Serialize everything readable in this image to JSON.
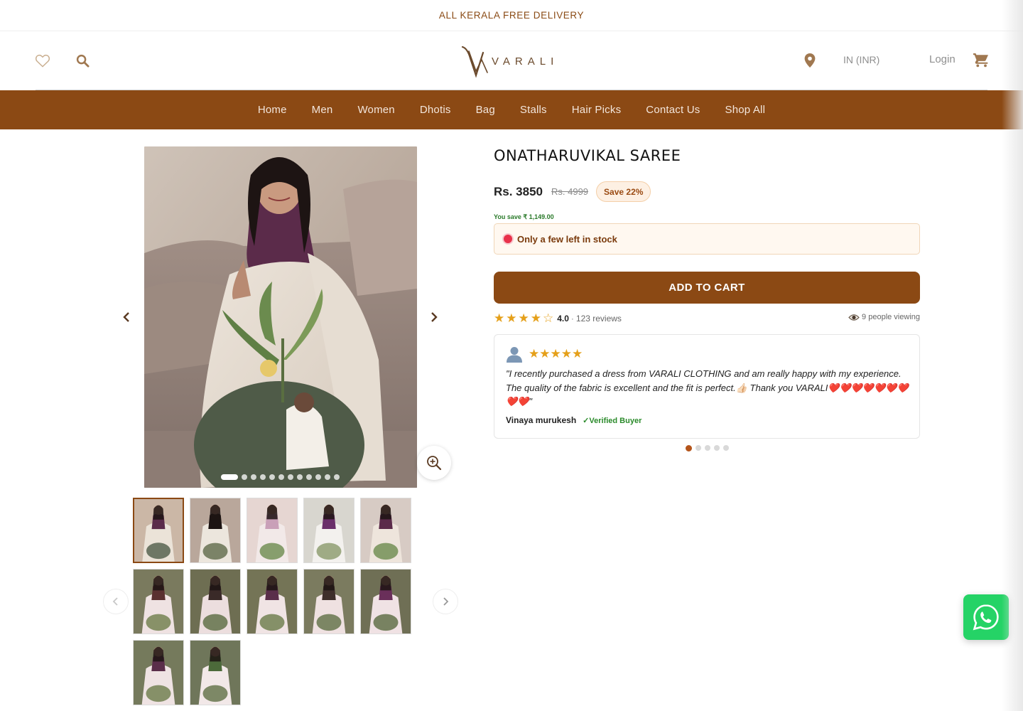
{
  "announcement": "ALL KERALA FREE DELIVERY",
  "header": {
    "logo_text": "VARALI",
    "currency": "IN (INR)",
    "login": "Login"
  },
  "nav": [
    "Home",
    "Men",
    "Women",
    "Dhotis",
    "Bag",
    "Stalls",
    "Hair Picks",
    "Contact Us",
    "Shop All"
  ],
  "gallery": {
    "photo_count": 12,
    "active_photo": 1,
    "thumbnail_count": 12
  },
  "product": {
    "title": "ONATHARUVIKAL SAREE",
    "price": "Rs. 3850",
    "compare_price": "Rs. 4999",
    "save_badge": "Save 22%",
    "you_save": "You save ₹ 1,149.00",
    "stock_message": "Only a few left in stock",
    "add_to_cart": "ADD TO CART",
    "rating": "4.0",
    "rating_stars": 4,
    "rating_sep": "·",
    "review_count": "123 reviews",
    "viewing": "9 people viewing"
  },
  "review": {
    "stars": "★★★★★",
    "text": "\"I recently purchased a dress from VARALI CLOTHING and am really happy with my experience. The quality of the fabric is excellent and the fit is perfect.👍🏻 Thank you VARALI❤️❤️❤️❤️❤️❤️❤️❤️❤️\"",
    "author": "Vinaya murukesh",
    "verified": "✓Verified Buyer",
    "slide_count": 5,
    "active_slide": 1
  },
  "colors": {
    "brand": "#8b4914",
    "accent_text": "#8a4a14",
    "star": "#e5a01a",
    "whatsapp": "#25d366"
  }
}
